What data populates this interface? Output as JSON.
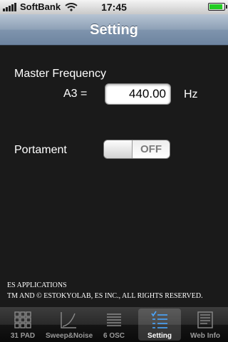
{
  "status_bar": {
    "carrier": "SoftBank",
    "time": "17:45",
    "icons": [
      "signal-icon",
      "wifi-icon",
      "battery-icon"
    ]
  },
  "nav": {
    "title": "Setting"
  },
  "settings": {
    "master_frequency_label": "Master Frequency",
    "a3_label": "A3 =",
    "frequency_value": "440.00",
    "unit_label": "Hz",
    "portament_label": "Portament",
    "portament_toggle": {
      "state_text": "OFF",
      "on": false
    }
  },
  "footer": {
    "line1": "ES APPLICATIONS",
    "line2": "TM AND © ESTOKYOLAB, ES INC., ALL RIGHTS RESERVED."
  },
  "tabbar": {
    "selected": "Setting",
    "tabs": [
      {
        "label": "31 PAD",
        "icon": "pad-grid-icon"
      },
      {
        "label": "Sweep&Noise",
        "icon": "sweep-curve-icon"
      },
      {
        "label": "6 OSC",
        "icon": "osc-lines-icon"
      },
      {
        "label": "Setting",
        "icon": "settings-checklist-icon"
      },
      {
        "label": "Web Info",
        "icon": "web-info-icon"
      }
    ]
  },
  "colors": {
    "nav_bar": "#8da0b6",
    "background": "#1a1a1a",
    "tab_selected": "#ffffff"
  }
}
